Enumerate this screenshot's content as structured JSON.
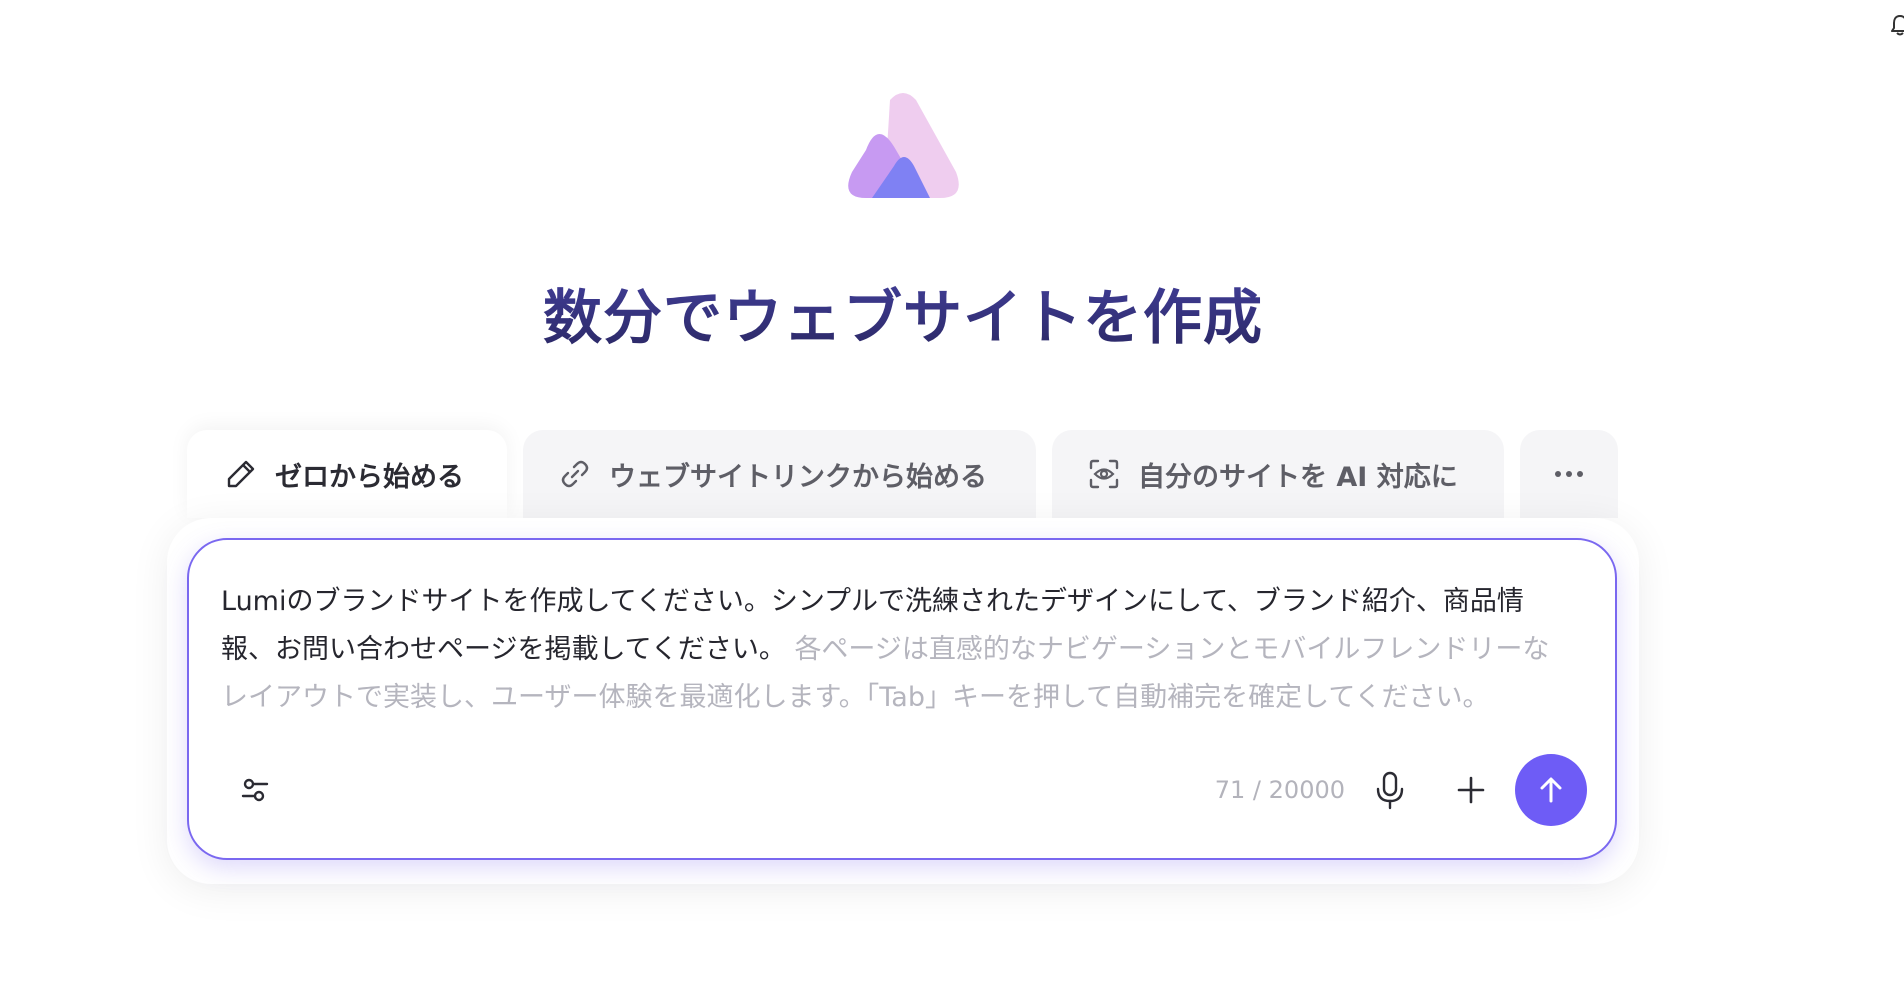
{
  "hero": {
    "title": "数分でウェブサイトを作成"
  },
  "tabs": [
    {
      "label": "ゼロから始める",
      "icon": "pencil-icon",
      "active": true
    },
    {
      "label": "ウェブサイトリンクから始める",
      "icon": "link-icon",
      "active": false
    },
    {
      "label": "自分のサイトを AI 対応に",
      "icon": "scan-eye-icon",
      "active": false
    },
    {
      "label": "...",
      "icon": "more-icon",
      "active": false
    }
  ],
  "composer": {
    "prompt_text": "Lumiのブランドサイトを作成してください。シンプルで洗練されたデザインにして、ブランド紹介、商品情報、お問い合わせページを掲載してください。",
    "suggestion_text": "各ページは直感的なナビゲーションとモバイルフレンドリーなレイアウトで実装し、ユーザー体験を最適化します。「Tab」キーを押して自動補完を確定してください。",
    "char_count": "71 / 20000"
  },
  "colors": {
    "accent": "#6e5cf6",
    "title": "#2f2e7a",
    "border": "#7a68f0"
  }
}
